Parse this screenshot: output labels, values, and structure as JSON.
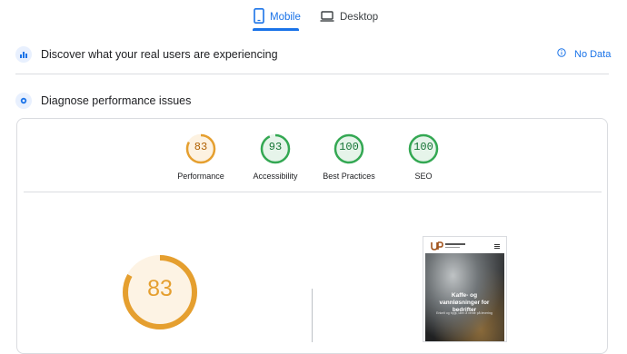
{
  "tabs": {
    "mobile": "Mobile",
    "desktop": "Desktop"
  },
  "field_data": {
    "title": "Discover what your real users are experiencing",
    "no_data": "No Data"
  },
  "lab_data": {
    "title": "Diagnose performance issues"
  },
  "scores": [
    {
      "label": "Performance",
      "value": "83",
      "color": "#e59f2f",
      "track": "#fdf2e1",
      "fraction": 0.83
    },
    {
      "label": "Accessibility",
      "value": "93",
      "color": "#34a853",
      "track": "#e6f4ea",
      "fraction": 0.93
    },
    {
      "label": "Best Practices",
      "value": "100",
      "color": "#34a853",
      "track": "#e6f4ea",
      "fraction": 1.0
    },
    {
      "label": "SEO",
      "value": "100",
      "color": "#34a853",
      "track": "#e6f4ea",
      "fraction": 1.0
    }
  ],
  "main_score": {
    "value": "83",
    "color": "#e59f2f",
    "fraction": 0.83
  },
  "preview": {
    "headline": "Kaffe- og vannløsninger for bedrifter",
    "subline": "Enkelt og trygt, uten å vente på levering"
  },
  "colors": {
    "accent": "#1a73e8",
    "average": "#e59f2f",
    "pass": "#34a853"
  }
}
